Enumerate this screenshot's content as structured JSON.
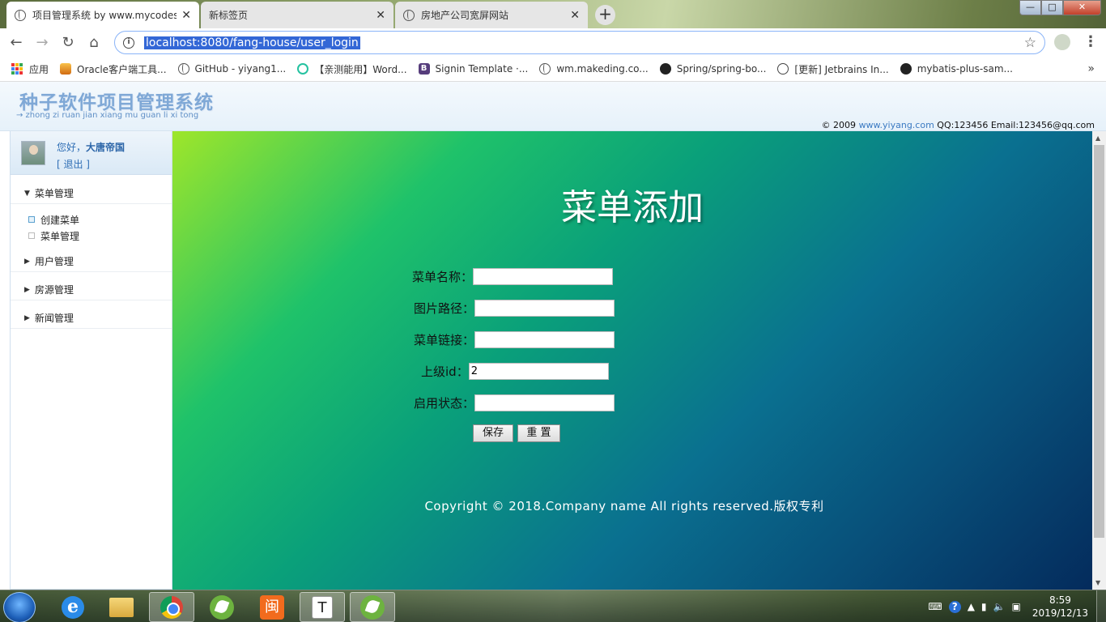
{
  "browser": {
    "tabs": [
      {
        "title": "项目管理系统 by www.mycodes",
        "active": true
      },
      {
        "title": "新标签页",
        "active": false
      },
      {
        "title": "房地产公司宽屏网站",
        "active": false
      }
    ],
    "newtab": "+",
    "close": "✕",
    "url": "localhost:8080/fang-house/user_login",
    "window_controls": {
      "min": "—",
      "max": "□",
      "close": "✕"
    },
    "bookmarks": [
      {
        "label": "应用"
      },
      {
        "label": "Oracle客户端工具..."
      },
      {
        "label": "GitHub - yiyang1..."
      },
      {
        "label": "【亲测能用】Word..."
      },
      {
        "label": "Signin Template ·..."
      },
      {
        "label": "wm.makeding.co..."
      },
      {
        "label": "Spring/spring-bo..."
      },
      {
        "label": "[更新] Jetbrains In..."
      },
      {
        "label": "mybatis-plus-sam..."
      }
    ],
    "bookmarks_more": "»"
  },
  "header": {
    "logo": "种子软件项目管理系统",
    "pinyin": "→ zhong zi ruan jian xiang mu guan li xi tong",
    "copy_prefix": "© 2009 ",
    "copy_link": "www.yiyang.com",
    "copy_suffix": " QQ:123456 Email:123456@qq.com"
  },
  "sidebar": {
    "greeting": "您好，",
    "username": "大唐帝国",
    "logout": "[ 退出 ]",
    "groups": [
      {
        "label": "菜单管理",
        "expanded": true,
        "items": [
          "创建菜单",
          "菜单管理"
        ]
      },
      {
        "label": "用户管理",
        "expanded": false
      },
      {
        "label": "房源管理",
        "expanded": false
      },
      {
        "label": "新闻管理",
        "expanded": false
      }
    ]
  },
  "main": {
    "title": "菜单添加",
    "fields": [
      {
        "label": "菜单名称：",
        "value": ""
      },
      {
        "label": "图片路径：",
        "value": ""
      },
      {
        "label": "菜单链接：",
        "value": ""
      },
      {
        "label": "上级id：",
        "value": "2"
      },
      {
        "label": "启用状态：",
        "value": ""
      }
    ],
    "save": "保存",
    "reset": "重 置",
    "footer": "Copyright © 2018.Company name All rights reserved.版权专利"
  },
  "taskbar": {
    "clock_time": "8:59",
    "clock_date": "2019/12/13",
    "orange_glyph": "闽",
    "t_glyph": "T"
  },
  "colors": {
    "accent": "#3367d6",
    "sidebar_link": "#2f6eb5",
    "main_gradient_start": "#9ee62a",
    "main_gradient_end": "#042b5c"
  }
}
